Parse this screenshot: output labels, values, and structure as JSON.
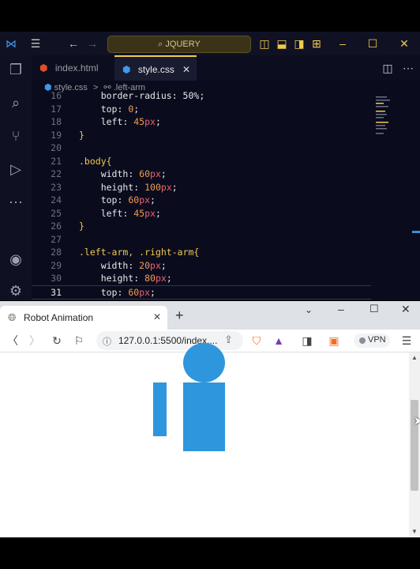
{
  "vscode": {
    "search_text": "JQUERY",
    "tabs": [
      {
        "label": "index.html",
        "icon": "html5-icon",
        "active": false
      },
      {
        "label": "style.css",
        "icon": "css3-icon",
        "active": true
      }
    ],
    "breadcrumb": {
      "file": "style.css",
      "separator": ">",
      "symbol": ".left-arm"
    },
    "code_lines": [
      {
        "n": "16",
        "tokens": [
          {
            "t": "    border-radius: 50%;",
            "c": "prop"
          }
        ]
      },
      {
        "n": "17",
        "tokens": [
          {
            "t": "    top",
            "c": "prop"
          },
          {
            "t": ": ",
            "c": "punc"
          },
          {
            "t": "0",
            "c": "num"
          },
          {
            "t": ";",
            "c": "punc"
          }
        ]
      },
      {
        "n": "18",
        "tokens": [
          {
            "t": "    left",
            "c": "prop"
          },
          {
            "t": ": ",
            "c": "punc"
          },
          {
            "t": "45",
            "c": "num"
          },
          {
            "t": "px",
            "c": "unit"
          },
          {
            "t": ";",
            "c": "punc"
          }
        ]
      },
      {
        "n": "19",
        "tokens": [
          {
            "t": "}",
            "c": "sel"
          }
        ]
      },
      {
        "n": "20",
        "tokens": []
      },
      {
        "n": "21",
        "tokens": [
          {
            "t": ".body{",
            "c": "sel"
          }
        ]
      },
      {
        "n": "22",
        "tokens": [
          {
            "t": "    width",
            "c": "prop"
          },
          {
            "t": ": ",
            "c": "punc"
          },
          {
            "t": "60",
            "c": "num"
          },
          {
            "t": "px",
            "c": "unit"
          },
          {
            "t": ";",
            "c": "punc"
          }
        ]
      },
      {
        "n": "23",
        "tokens": [
          {
            "t": "    height",
            "c": "prop"
          },
          {
            "t": ": ",
            "c": "punc"
          },
          {
            "t": "100",
            "c": "num"
          },
          {
            "t": "px",
            "c": "unit"
          },
          {
            "t": ";",
            "c": "punc"
          }
        ]
      },
      {
        "n": "24",
        "tokens": [
          {
            "t": "    top",
            "c": "prop"
          },
          {
            "t": ": ",
            "c": "punc"
          },
          {
            "t": "60",
            "c": "num"
          },
          {
            "t": "px",
            "c": "unit"
          },
          {
            "t": ";",
            "c": "punc"
          }
        ]
      },
      {
        "n": "25",
        "tokens": [
          {
            "t": "    left",
            "c": "prop"
          },
          {
            "t": ": ",
            "c": "punc"
          },
          {
            "t": "45",
            "c": "num"
          },
          {
            "t": "px",
            "c": "unit"
          },
          {
            "t": ";",
            "c": "punc"
          }
        ]
      },
      {
        "n": "26",
        "tokens": [
          {
            "t": "}",
            "c": "sel"
          }
        ]
      },
      {
        "n": "27",
        "tokens": []
      },
      {
        "n": "28",
        "tokens": [
          {
            "t": ".left-arm, .right-arm{",
            "c": "sel"
          }
        ]
      },
      {
        "n": "29",
        "tokens": [
          {
            "t": "    width",
            "c": "prop"
          },
          {
            "t": ": ",
            "c": "punc"
          },
          {
            "t": "20",
            "c": "num"
          },
          {
            "t": "px",
            "c": "unit"
          },
          {
            "t": ";",
            "c": "punc"
          }
        ]
      },
      {
        "n": "30",
        "tokens": [
          {
            "t": "    height",
            "c": "prop"
          },
          {
            "t": ": ",
            "c": "punc"
          },
          {
            "t": "80",
            "c": "num"
          },
          {
            "t": "px",
            "c": "unit"
          },
          {
            "t": ";",
            "c": "punc"
          }
        ]
      },
      {
        "n": "31",
        "tokens": [
          {
            "t": "    top",
            "c": "prop"
          },
          {
            "t": ": ",
            "c": "punc"
          },
          {
            "t": "60",
            "c": "num"
          },
          {
            "t": "px",
            "c": "unit"
          },
          {
            "t": ";",
            "c": "punc"
          }
        ],
        "current": true
      }
    ],
    "colors": {
      "accent": "#f2c94c",
      "background": "#0a0c1e"
    }
  },
  "browser": {
    "tab_title": "Robot Animation",
    "new_tab": "+",
    "address": "127.0.0.1:5500/index....",
    "vpn_label": "VPN",
    "robot_color": "#2e96dc"
  }
}
